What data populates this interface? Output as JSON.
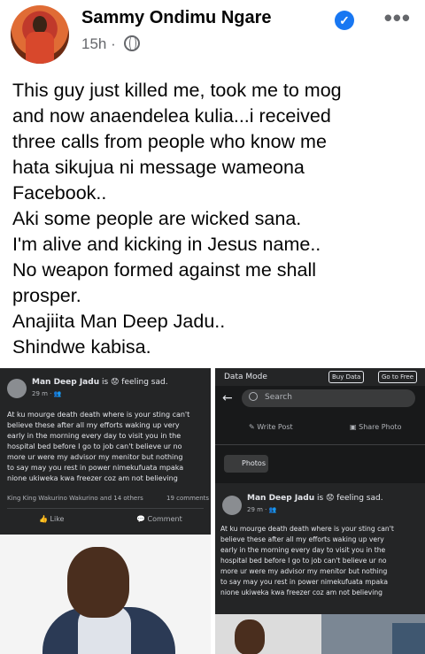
{
  "post": {
    "author": "Sammy Ondimu Ngare",
    "verified_icon": "verified-check-icon",
    "time": "15h",
    "separator": "·",
    "audience_icon": "globe-icon",
    "more_label": "•••",
    "text_lines": [
      "This guy just killed me, took me to mog",
      "and now anaendelea kulia...i received",
      "three calls from people who know me",
      "hata sikujua ni message wameona",
      "Facebook..",
      "Aki some people are wicked sana.",
      "I'm alive and kicking in Jesus name..",
      "No weapon formed against me shall",
      "prosper.",
      "Anajiita Man Deep Jadu..",
      "Shindwe kabisa."
    ]
  },
  "left_screenshot": {
    "poster": "Man Deep Jadu",
    "feeling": "is 😟 feeling sad.",
    "sub": "29 m · 👥",
    "body_lines": [
      "At ku mourge death death where is your sting can't",
      "believe these after all my efforts waking up very",
      "early in the morning every day to visit you in the",
      "hospital bed before I go to job  can't believe ur no",
      "more ur were my advisor   my menitor but nothing",
      "to say may you rest in power nimekufuata mpaka",
      "nione ukiweka kwa freezer coz am not believing"
    ],
    "reactions": "King King Wakurino Wakurino and 14 others",
    "comments_count": "19 comments",
    "like_label": "Like",
    "comment_label": "Comment"
  },
  "right_screenshot": {
    "data_mode": "Data Mode",
    "buy_data": "Buy Data",
    "go_free": "Go to Free",
    "search_placeholder": "Search",
    "write_post": "Write Post",
    "share_photo": "Share Photo",
    "photos": "Photos",
    "poster": "Man Deep Jadu",
    "feeling": "is 😟 feeling sad.",
    "sub": "29 m · 👥",
    "body_lines": [
      "At ku mourge death death where is your sting can't",
      "believe these after all my efforts waking up very",
      "early in the morning every day to visit you in the",
      "hospital bed before I go to job  can't believe ur no",
      "more ur were my advisor   my menitor but nothing",
      "to say may you rest in power nimekufuata mpaka",
      "nione ukiweka kwa freezer coz am not believing"
    ]
  }
}
